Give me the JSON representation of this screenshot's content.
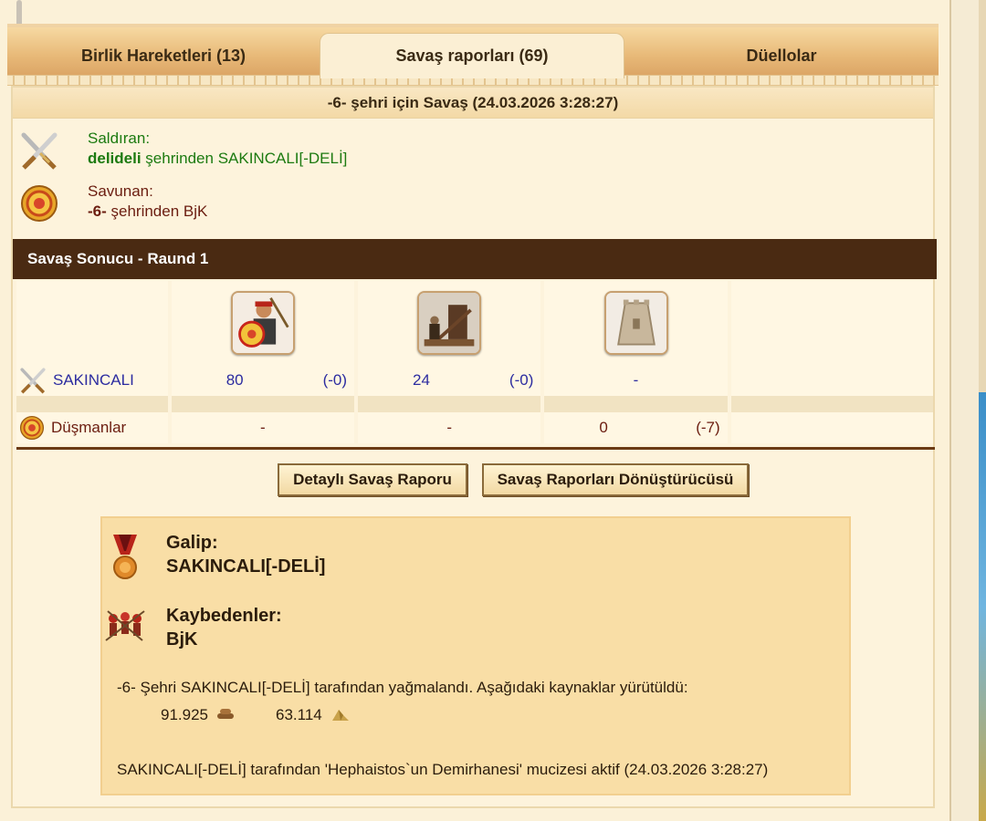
{
  "tabs": [
    {
      "label": "Birlik Hareketleri (13)",
      "active": false
    },
    {
      "label": "Savaş raporları (69)",
      "active": true
    },
    {
      "label": "Düellolar",
      "active": false
    }
  ],
  "report": {
    "title": "-6- şehri için Savaş (24.03.2026 3:28:27)",
    "attacker": {
      "label": "Saldıran:",
      "city": "delideli",
      "rest": " şehrinden SAKINCALI[-DELİ]"
    },
    "defender": {
      "label": "Savunan:",
      "city": "-6-",
      "rest": " şehrinden BjK"
    },
    "result_title": "Savaş Sonucu - Raund 1"
  },
  "units": {
    "attacker_row": {
      "name": "SAKINCALI",
      "cells": [
        {
          "count": "80",
          "loss": "(-0)"
        },
        {
          "count": "24",
          "loss": "(-0)"
        },
        {
          "count": "-",
          "loss": ""
        }
      ]
    },
    "defender_row": {
      "name": "Düşmanlar",
      "cells": [
        {
          "count": "-",
          "loss": ""
        },
        {
          "count": "-",
          "loss": ""
        },
        {
          "count": "0",
          "loss": "(-7)"
        }
      ]
    }
  },
  "buttons": {
    "detailed": "Detaylı Savaş Raporu",
    "converter": "Savaş Raporları Dönüştürücüsü"
  },
  "summary": {
    "winner_label": "Galip:",
    "winner": "SAKINCALI[-DELİ]",
    "losers_label": "Kaybedenler:",
    "losers": "BjK",
    "loot_text": "-6- Şehri SAKINCALI[-DELİ] tarafından yağmalandı. Aşağıdaki kaynaklar yürütüldü:",
    "resource1": "91.925",
    "resource2": "63.114",
    "miracle_text": "SAKINCALI[-DELİ] tarafından 'Hephaistos`un Demirhanesi' mucizesi aktif (24.03.2026 3:28:27)"
  }
}
